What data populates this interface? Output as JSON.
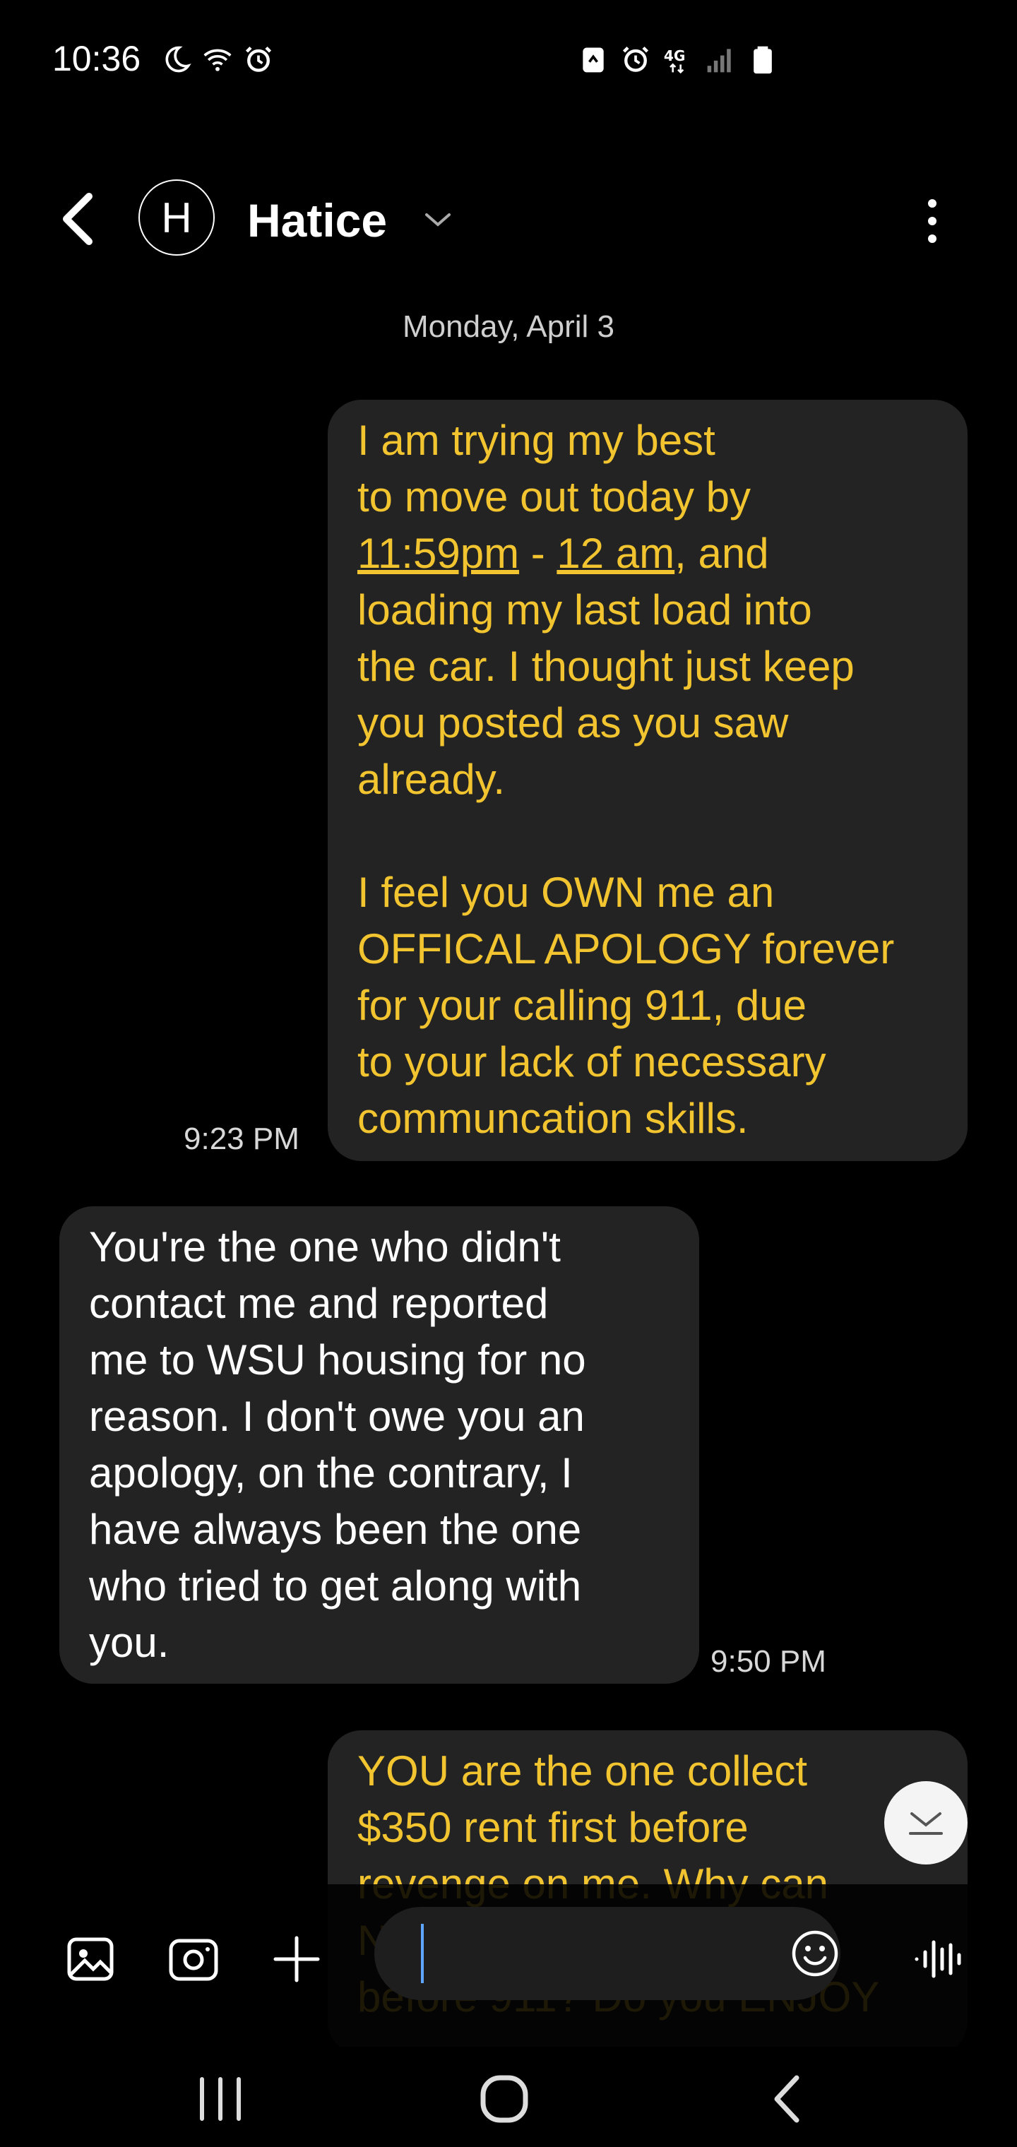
{
  "status_bar": {
    "time": "10:36",
    "left_icons": [
      "moon-icon",
      "wifi-icon",
      "alarm-icon"
    ],
    "right_icons": [
      "recycle-icon",
      "alarm-icon",
      "4g-icon",
      "signal-icon",
      "battery-icon"
    ]
  },
  "header": {
    "avatar_letter": "H",
    "contact_name": "Hatice"
  },
  "conversation": {
    "date": "Monday, April 3",
    "messages": [
      {
        "direction": "outgoing",
        "line1": "I am trying my best\nto move out today by",
        "link1": "11:59pm",
        "sep": " - ",
        "link2": "12 am",
        "rest": ", and\nloading my last load into\nthe car. I thought just keep\nyou posted as you saw\nalready.\n\nI feel you OWN me an\nOFFICAL APOLOGY forever\nfor your calling 911, due\nto your lack of necessary\ncommuncation skills.",
        "time": "9:23 PM"
      },
      {
        "direction": "incoming",
        "text": "You're the one who didn't\ncontact me and reported\nme to WSU housing for no\nreason. I don't owe you an\napology, on the contrary, I\nhave always been the one\nwho tried to get along with\nyou.",
        "time": "9:50 PM"
      },
      {
        "direction": "outgoing",
        "text": "YOU are the one collect\n$350 rent first before\nrevenge on me. Why can\nNOT you contact me\nbefore 911? Do you ENJOY"
      }
    ]
  },
  "colors": {
    "outgoing_text": "#f2c530",
    "bubble_bg": "#232323",
    "background": "#000000",
    "caret": "#5ea6ff"
  },
  "composer": {
    "placeholder": ""
  }
}
